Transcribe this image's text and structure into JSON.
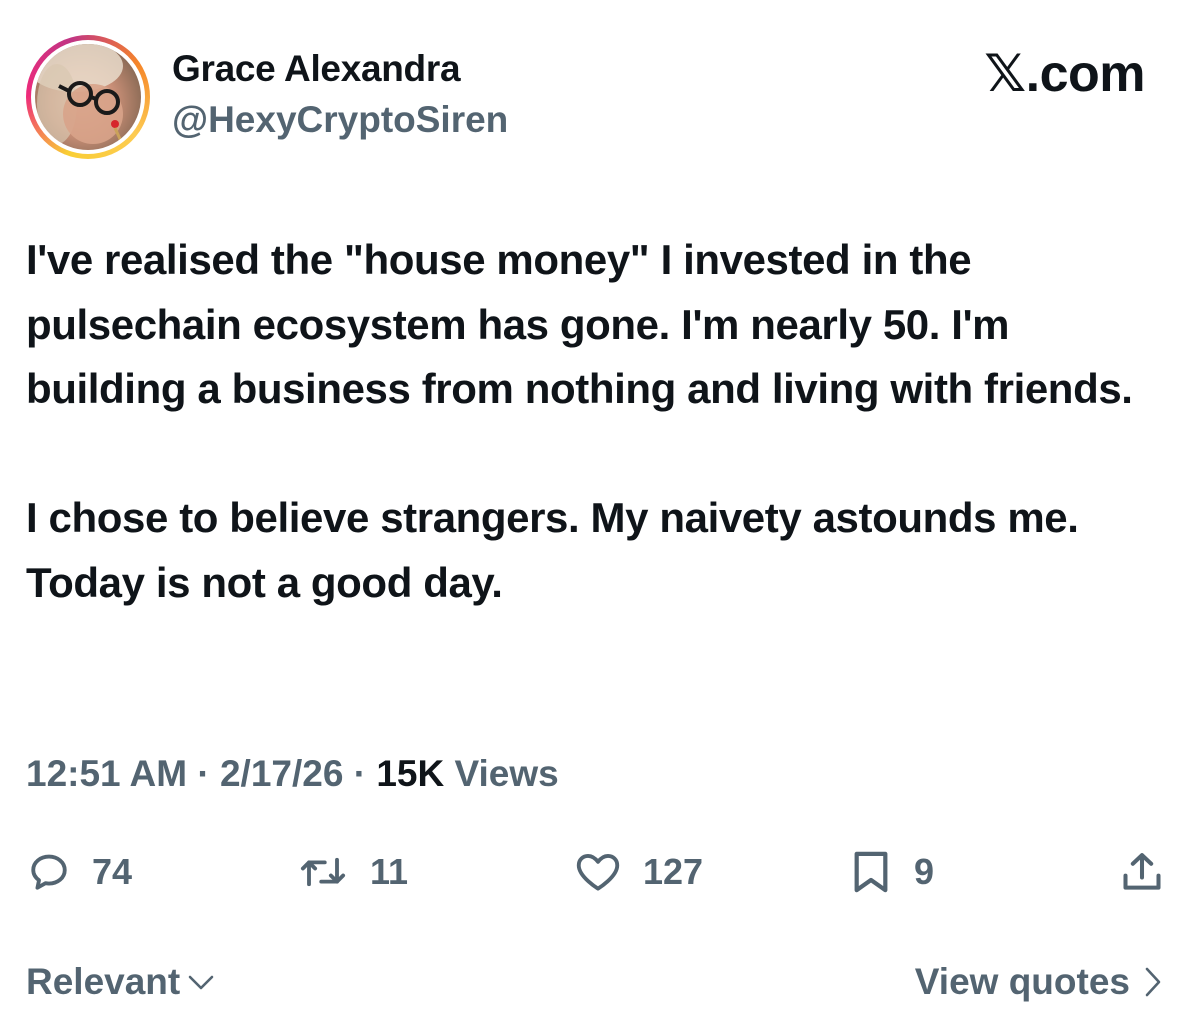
{
  "author": {
    "display_name": "Grace Alexandra",
    "handle": "@HexyCryptoSiren",
    "avatar_icon": "profile-photo"
  },
  "brand": "𝕏.com",
  "tweet": {
    "paragraphs": [
      "I've realised the \"house money\" I invested in the pulsechain ecosystem has gone. I'm nearly 50. I'm building a business from nothing and living with friends.",
      "I chose to believe strangers. My naivety astounds me. Today is not a good day."
    ],
    "time": "12:51 AM",
    "date": "2/17/26",
    "separator": "·",
    "views_count": "15K",
    "views_label": "Views"
  },
  "actions": {
    "replies": {
      "icon": "reply-icon",
      "count": "74"
    },
    "reposts": {
      "icon": "repost-icon",
      "count": "11"
    },
    "likes": {
      "icon": "heart-icon",
      "count": "127"
    },
    "bookmarks": {
      "icon": "bookmark-icon",
      "count": "9"
    },
    "share": {
      "icon": "share-icon"
    }
  },
  "footer": {
    "sort_label": "Relevant",
    "view_quotes_label": "View quotes"
  },
  "colors": {
    "text_primary": "#0f1419",
    "text_secondary": "#536471",
    "background": "#ffffff"
  }
}
